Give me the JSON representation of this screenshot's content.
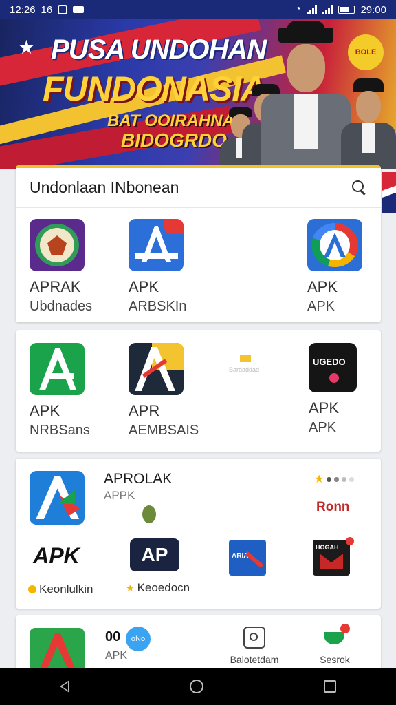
{
  "status_bar": {
    "time": "12:26",
    "left_extra": "16",
    "right_time": "29:00"
  },
  "banner": {
    "line1": "PUSA UNDOHAN",
    "line2": "FUNDONASIA",
    "line3": "BAT OOIRAHNAN",
    "line4": "BIDOGRDO",
    "badge": "BOLE"
  },
  "search": {
    "title": "Undonlaan INbonean"
  },
  "card1_apps": [
    {
      "label1": "APRAK",
      "label2": "Ubdnades"
    },
    {
      "label1": "APK",
      "label2": "ARBSKIn"
    },
    {
      "label1": "APK",
      "label2": "APK"
    }
  ],
  "card2_apps": [
    {
      "label1": "APK",
      "label2": "NRBSans"
    },
    {
      "label1": "APR",
      "label2": "AEMBSAIS"
    },
    {
      "label1": "Bardaddad",
      "label2": ""
    },
    {
      "label1": "APK",
      "label2": "APK",
      "icon_text": "UGEDO"
    }
  ],
  "card3": {
    "featured_title": "APROLAK",
    "featured_sub": "APPK",
    "rating_label": "Ronn",
    "apps": [
      {
        "icon_text": "APK",
        "label": "Keonlulkin"
      },
      {
        "icon_text": "AP",
        "label": "Keoedocn"
      },
      {
        "icon_text": "ARIA",
        "label": ""
      },
      {
        "icon_text": "HOGAH",
        "label": ""
      }
    ]
  },
  "card4": {
    "app_title": "00",
    "app_sub": "APK",
    "chip": "oNo",
    "item2_label": "Balotetdam",
    "item3_label": "Sesrok"
  },
  "colors": {
    "status_bg": "#1b2a78",
    "accent_yellow": "#f0c22a",
    "red": "#d72638"
  }
}
